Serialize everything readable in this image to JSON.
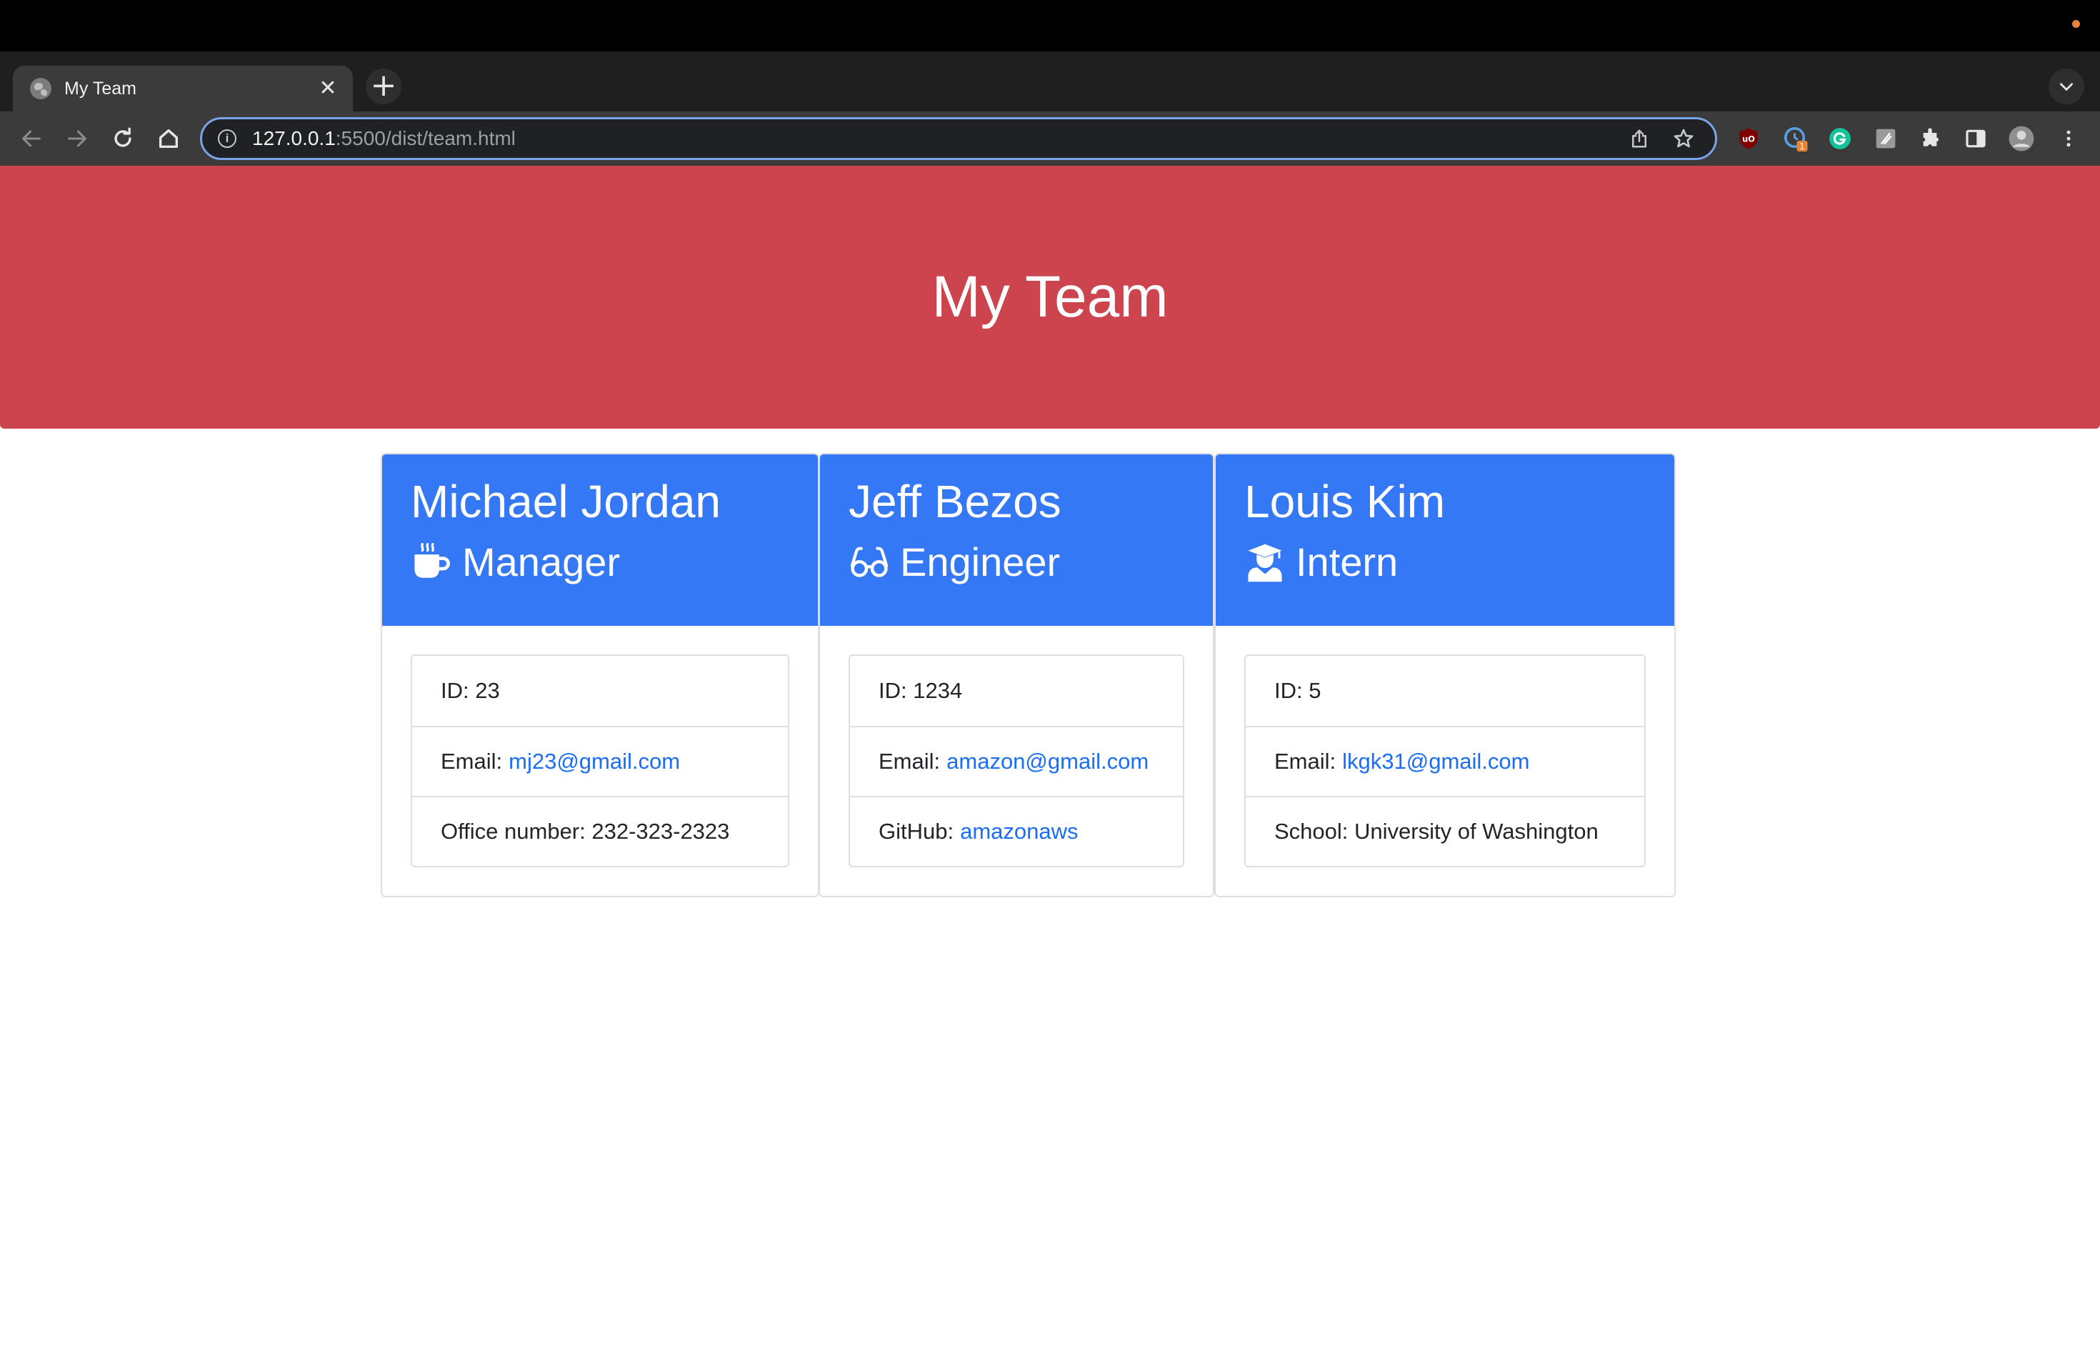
{
  "browser": {
    "tab": {
      "title": "My Team"
    },
    "address": {
      "host": "127.0.0.1",
      "path": ":5500/dist/team.html"
    },
    "extensions": {
      "badge_count": "1"
    }
  },
  "page": {
    "title": "My Team",
    "cards": [
      {
        "name": "Michael Jordan",
        "role": "Manager",
        "role_icon": "mug-hot-icon",
        "id_text": "ID: 23",
        "email_label": "Email:",
        "email": "mj23@gmail.com",
        "extra_text": "Office number: 232-323-2323"
      },
      {
        "name": "Jeff Bezos",
        "role": "Engineer",
        "role_icon": "glasses-icon",
        "id_text": "ID: 1234",
        "email_label": "Email:",
        "email": "amazon@gmail.com",
        "extra_label": "GitHub:",
        "extra_link": "amazonaws"
      },
      {
        "name": "Louis Kim",
        "role": "Intern",
        "role_icon": "user-graduate-icon",
        "id_text": "ID: 5",
        "email_label": "Email:",
        "email": "lkgk31@gmail.com",
        "extra_text": "School: University of Washington"
      }
    ]
  },
  "colors": {
    "header_red": "#cc444d",
    "card_header_blue": "#3478f6",
    "link_blue": "#1a6ef5"
  }
}
